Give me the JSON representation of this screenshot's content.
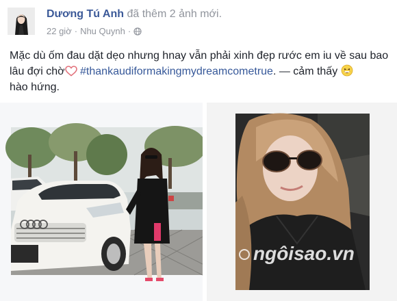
{
  "post": {
    "author": "Dương Tú Anh",
    "action": "đã thêm 2 ảnh mới.",
    "time": "22 giờ",
    "separator": "·",
    "location": "Nhu Quynh",
    "separator2": "·",
    "text_main": "Mặc dù ốm đau dặt dẹo nhưng hnay vẫn phải xinh đẹp rước em iu về sau bao lâu đợi chờ",
    "hashtag": "#thankaudiformakingmydreamcometrue",
    "feeling_prefix": ". — cảm thấy",
    "feeling": "hào hứng."
  },
  "icons": {
    "heart": "heart-icon",
    "globe": "globe-icon",
    "excited_emoji": "excited-face-icon"
  },
  "watermark": {
    "text": "ngôisao.vn"
  },
  "colors": {
    "author": "#3b5998",
    "hashtag": "#365899",
    "meta": "#90949c"
  }
}
